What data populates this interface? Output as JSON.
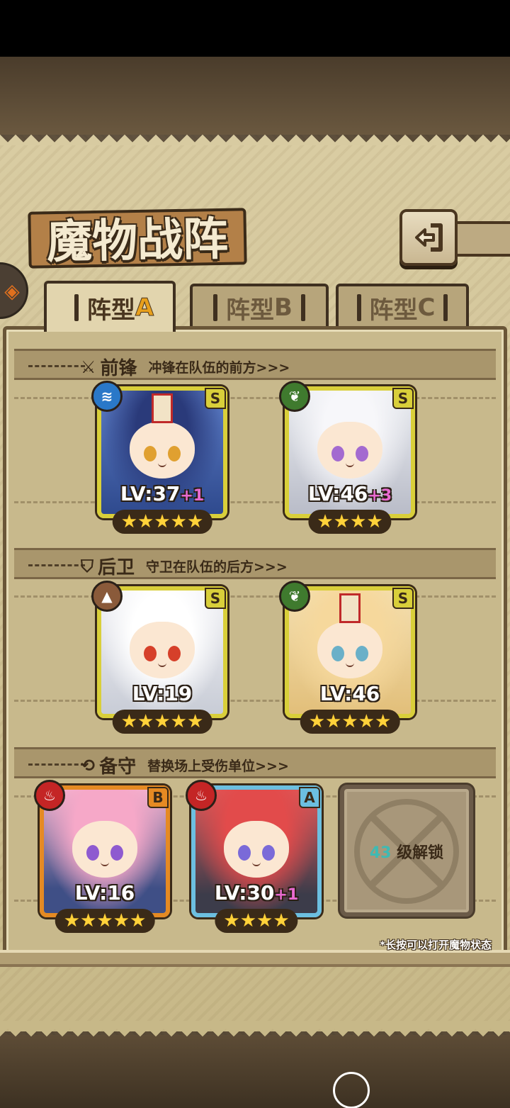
{
  "screen_title": "魔物战阵",
  "back_icon": "back-arrow-icon",
  "tabs": [
    {
      "label": "阵型",
      "letter": "A",
      "active": true
    },
    {
      "label": "阵型",
      "letter": "B",
      "active": false
    },
    {
      "label": "阵型",
      "letter": "C",
      "active": false
    }
  ],
  "sections": {
    "front": {
      "title": "前锋",
      "desc": "冲锋在队伍的前方>>>",
      "icon": "sword-icon"
    },
    "rear": {
      "title": "后卫",
      "desc": "守卫在队伍的后方>>>",
      "icon": "shield-icon"
    },
    "reserve": {
      "title": "备守",
      "desc": "替换场上受伤单位>>>",
      "icon": "swap-icon"
    }
  },
  "cards": {
    "front1": {
      "element": "water-element-icon",
      "rank": "S",
      "level": "LV:37",
      "plus": "+1",
      "stars": 5
    },
    "front2": {
      "element": "wood-element-icon",
      "rank": "S",
      "level": "LV:46",
      "plus": "+3",
      "stars": 4
    },
    "rear1": {
      "element": "earth-element-icon",
      "rank": "S",
      "level": "LV:19",
      "plus": "",
      "stars": 5
    },
    "rear2": {
      "element": "wood-element-icon",
      "rank": "S",
      "level": "LV:46",
      "plus": "",
      "stars": 5
    },
    "res1": {
      "element": "fire-element-icon",
      "rank": "B",
      "level": "LV:16",
      "plus": "",
      "stars": 5
    },
    "res2": {
      "element": "fire-element-icon",
      "rank": "A",
      "level": "LV:30",
      "plus": "+1",
      "stars": 4
    }
  },
  "locked_slot": {
    "level": "43",
    "text": "级解锁"
  },
  "hint": "*长按可以打开魔物状态",
  "colors": {
    "accent": "#e8a01c",
    "parchment": "#d9cca2",
    "frame": "#3a2a18"
  }
}
